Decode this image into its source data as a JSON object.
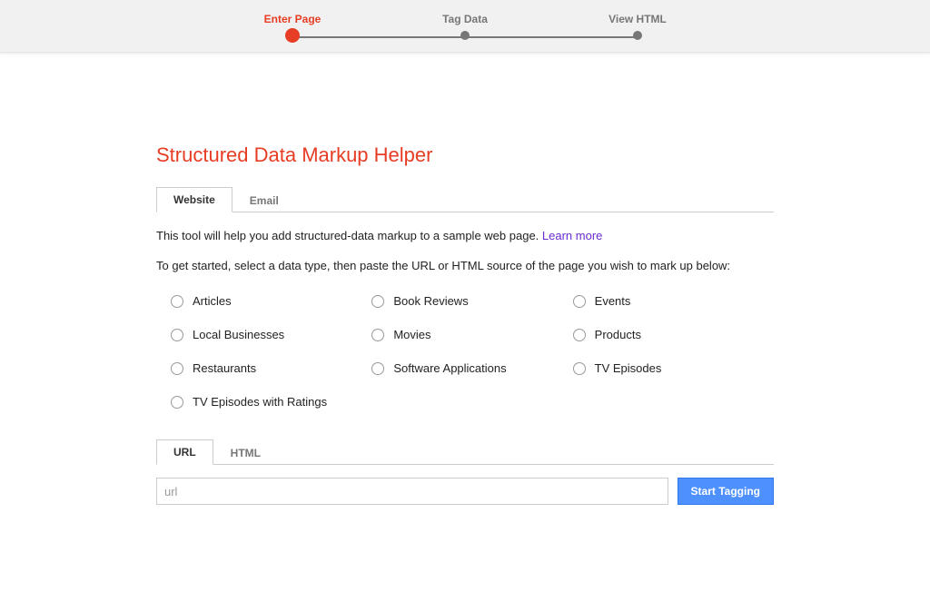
{
  "progress": {
    "steps": [
      {
        "label": "Enter Page",
        "active": true
      },
      {
        "label": "Tag Data",
        "active": false
      },
      {
        "label": "View HTML",
        "active": false
      }
    ]
  },
  "page": {
    "title": "Structured Data Markup Helper"
  },
  "content_tabs": {
    "items": [
      "Website",
      "Email"
    ],
    "active_index": 0
  },
  "intro": {
    "text": "This tool will help you add structured-data markup to a sample web page. ",
    "learn_more": "Learn more"
  },
  "subintro": "To get started, select a data type, then paste the URL or HTML source of the page you wish to mark up below:",
  "data_types": [
    "Articles",
    "Book Reviews",
    "Events",
    "Local Businesses",
    "Movies",
    "Products",
    "Restaurants",
    "Software Applications",
    "TV Episodes",
    "TV Episodes with Ratings"
  ],
  "source_tabs": {
    "items": [
      "URL",
      "HTML"
    ],
    "active_index": 0
  },
  "url_input": {
    "placeholder": "url",
    "value": ""
  },
  "start_button": "Start Tagging"
}
